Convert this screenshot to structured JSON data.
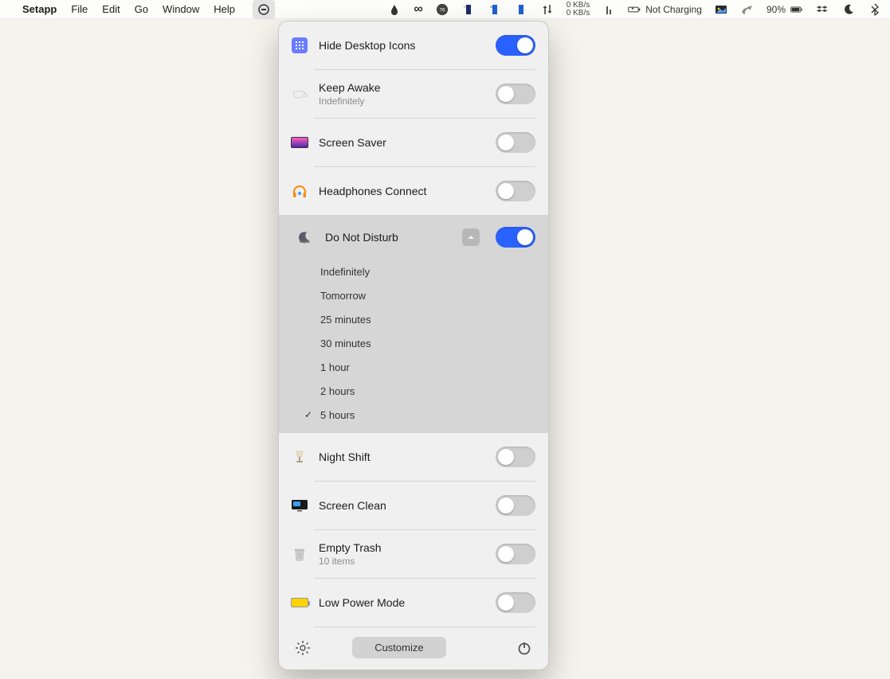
{
  "menubar": {
    "app": "Setapp",
    "items": [
      "File",
      "Edit",
      "Go",
      "Window",
      "Help"
    ],
    "net_up": "0 KB/s",
    "net_down": "0 KB/s",
    "charging_label": "Not Charging",
    "battery_pct": "90%",
    "cpu_temp": "76"
  },
  "panel": {
    "rows": [
      {
        "key": "hide-desktop",
        "title": "Hide Desktop Icons",
        "subtitle": "",
        "on": true
      },
      {
        "key": "keep-awake",
        "title": "Keep Awake",
        "subtitle": "Indefinitely",
        "on": false
      },
      {
        "key": "screen-saver",
        "title": "Screen Saver",
        "subtitle": "",
        "on": false
      },
      {
        "key": "headphones",
        "title": "Headphones Connect",
        "subtitle": "",
        "on": false
      }
    ],
    "dnd": {
      "title": "Do Not Disturb",
      "on": true,
      "options": [
        "Indefinitely",
        "Tomorrow",
        "25 minutes",
        "30 minutes",
        "1 hour",
        "2 hours",
        "5 hours"
      ],
      "selected_index": 6
    },
    "rows_after": [
      {
        "key": "night-shift",
        "title": "Night Shift",
        "subtitle": "",
        "on": false
      },
      {
        "key": "screen-clean",
        "title": "Screen Clean",
        "subtitle": "",
        "on": false
      },
      {
        "key": "empty-trash",
        "title": "Empty Trash",
        "subtitle": "10 items",
        "on": false
      },
      {
        "key": "low-power",
        "title": "Low Power Mode",
        "subtitle": "",
        "on": false
      }
    ],
    "customize_label": "Customize"
  }
}
